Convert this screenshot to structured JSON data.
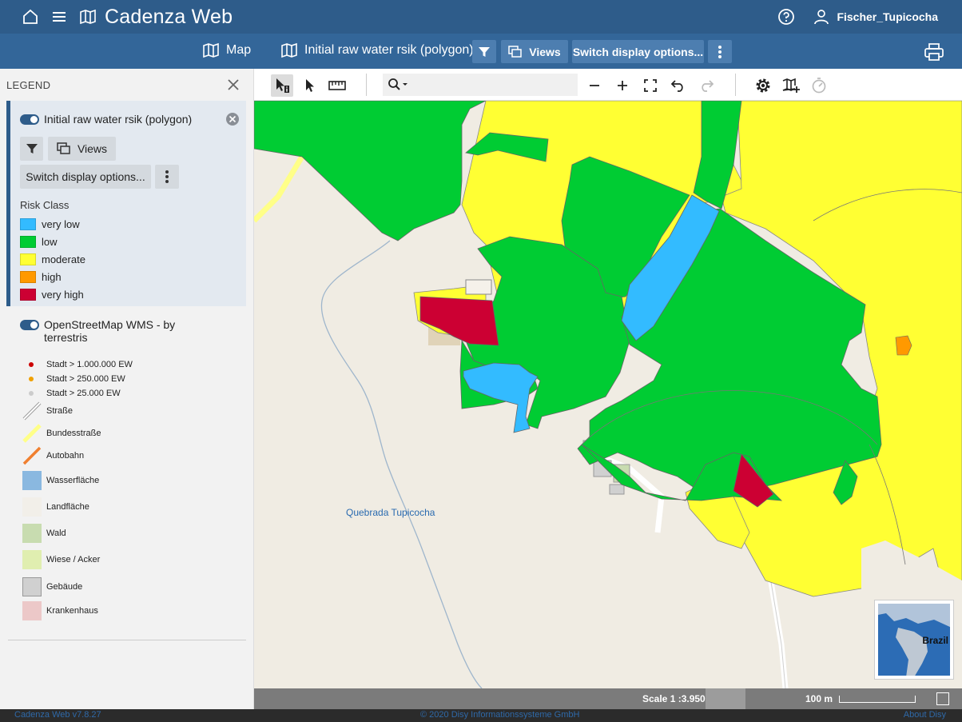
{
  "app": {
    "title": "Cadenza Web",
    "user": "Fischer_Tupicocha"
  },
  "subbar": {
    "map_tab": "Map",
    "layer_tab": "Initial raw water rsik (polygon)",
    "views_label": "Views",
    "switch_label": "Switch display options..."
  },
  "legend": {
    "heading": "LEGEND",
    "layer1": {
      "name": "Initial raw water rsik (polygon)",
      "views_label": "Views",
      "switch_label": "Switch display options...",
      "risk_title": "Risk Class",
      "classes": [
        {
          "label": "very low",
          "color": "#33bbff"
        },
        {
          "label": "low",
          "color": "#00cc33"
        },
        {
          "label": "moderate",
          "color": "#ffff33"
        },
        {
          "label": "high",
          "color": "#ff9900"
        },
        {
          "label": "very high",
          "color": "#cc0033"
        }
      ]
    },
    "layer2": {
      "name_line1": "OpenStreetMap WMS - by",
      "name_line2": "terrestris",
      "items": [
        {
          "label": "Stadt > 1.000.000 EW",
          "kind": "dot",
          "color": "#cc0000"
        },
        {
          "label": "Stadt > 250.000 EW",
          "kind": "dot",
          "color": "#f0a000"
        },
        {
          "label": "Stadt > 25.000 EW",
          "kind": "dot",
          "color": "#cccccc"
        },
        {
          "label": "Straße",
          "kind": "line",
          "color": "#bbbbbb"
        },
        {
          "label": "Bundesstraße",
          "kind": "line",
          "color": "#ffff88"
        },
        {
          "label": "Autobahn",
          "kind": "line",
          "color": "#f08030"
        },
        {
          "label": "Wasserfläche",
          "kind": "area",
          "color": "#8ab8e0"
        },
        {
          "label": "Landfläche",
          "kind": "area",
          "color": "#f2efe9"
        },
        {
          "label": "Wald",
          "kind": "area",
          "color": "#c8dcb0"
        },
        {
          "label": "Wiese / Acker",
          "kind": "area",
          "color": "#e0eeb0"
        },
        {
          "label": "Gebäude",
          "kind": "area",
          "color": "#d0d0d0"
        },
        {
          "label": "Krankenhaus",
          "kind": "area",
          "color": "#ecc8c8"
        }
      ]
    }
  },
  "map": {
    "place_label": "Quebrada Tupicocha",
    "overview_label": "Brazil",
    "scale": "Scale 1 :3.950",
    "distance": "100 m"
  },
  "footer": {
    "version": "Cadenza Web v7.8.27",
    "copyright": "© 2020 Disy Informationssysteme GmbH",
    "about": "About Disy"
  }
}
